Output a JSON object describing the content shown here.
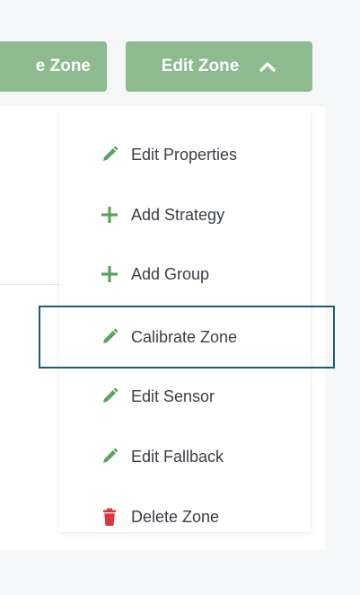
{
  "toolbar": {
    "left_button_label": "e Zone",
    "edit_zone_label": "Edit Zone",
    "edit_zone_icon": "chevron-up-icon"
  },
  "dropdown": {
    "items": [
      {
        "label": "Edit Properties",
        "icon": "pencil-icon"
      },
      {
        "label": "Add Strategy",
        "icon": "plus-icon"
      },
      {
        "label": "Add Group",
        "icon": "plus-icon"
      },
      {
        "label": "Calibrate Zone",
        "icon": "pencil-icon"
      },
      {
        "label": "Edit Sensor",
        "icon": "pencil-icon"
      },
      {
        "label": "Edit Fallback",
        "icon": "pencil-icon"
      },
      {
        "label": "Delete Zone",
        "icon": "trash-icon"
      }
    ]
  },
  "colors": {
    "button_green": "#8dbb8f",
    "icon_green": "#5aa35e",
    "delete_red": "#d9373c",
    "highlight_border": "#1e5f74"
  }
}
